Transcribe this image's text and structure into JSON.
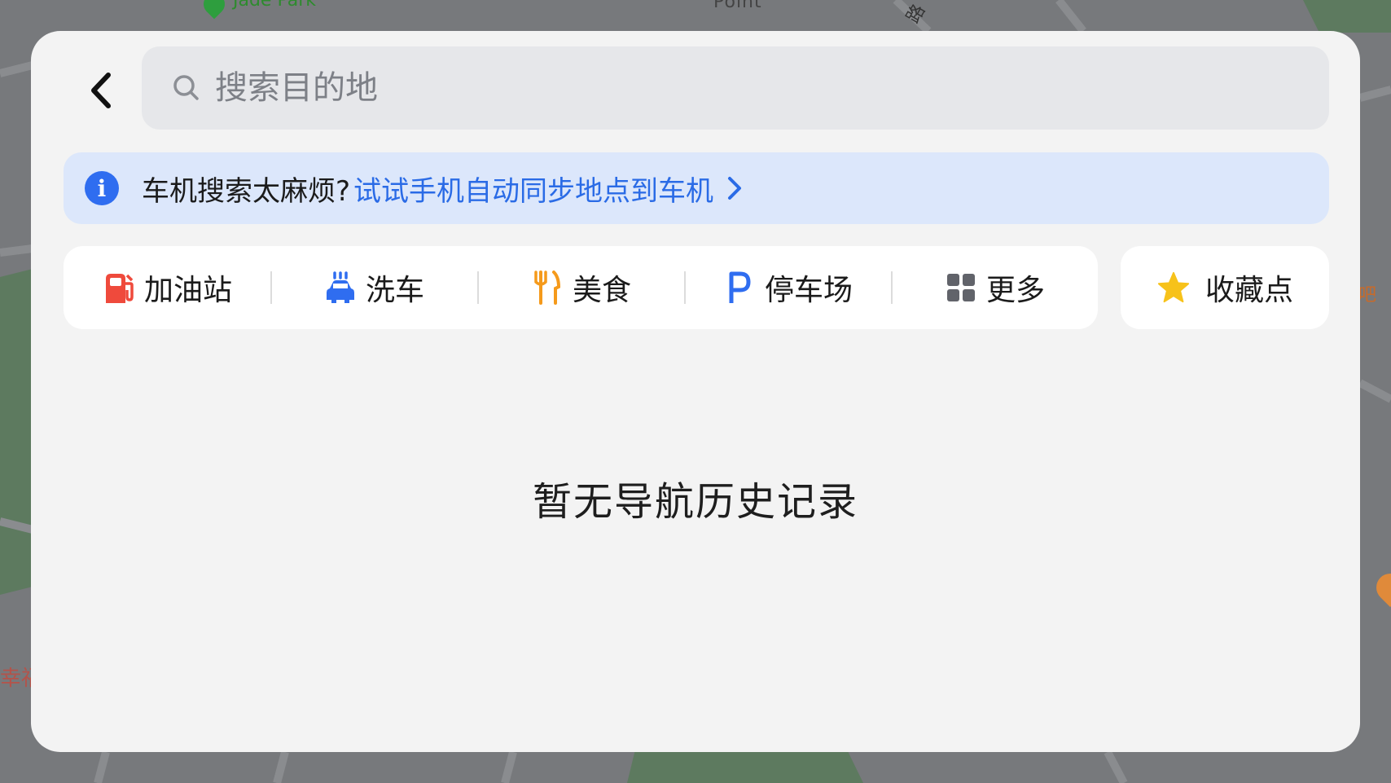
{
  "map": {
    "park_label": "Jade Park",
    "point_label": "Point",
    "road_label": "路",
    "left_label": "幸福",
    "right_label": "吧"
  },
  "colors": {
    "panel_bg": "#f3f3f3",
    "search_bg": "#e6e7ea",
    "banner_bg": "#dce7fb",
    "accent_blue": "#2a6be6",
    "gas_red": "#ef4a3c",
    "food_orange": "#f59a1b",
    "star_yellow": "#f7c21a"
  },
  "search": {
    "placeholder": "搜索目的地",
    "icon": "search-icon"
  },
  "back": {
    "icon": "chevron-left-icon"
  },
  "banner": {
    "icon": "info-icon",
    "text": "车机搜索太麻烦?",
    "link": "试试手机自动同步地点到车机",
    "chevron": "chevron-right-icon"
  },
  "categories": [
    {
      "label": "加油站",
      "icon": "gas-station-icon"
    },
    {
      "label": "洗车",
      "icon": "car-wash-icon"
    },
    {
      "label": "美食",
      "icon": "food-icon"
    },
    {
      "label": "停车场",
      "icon": "parking-icon"
    },
    {
      "label": "更多",
      "icon": "grid-icon"
    }
  ],
  "favorites": {
    "label": "收藏点",
    "icon": "star-icon"
  },
  "empty_state": "暂无导航历史记录"
}
